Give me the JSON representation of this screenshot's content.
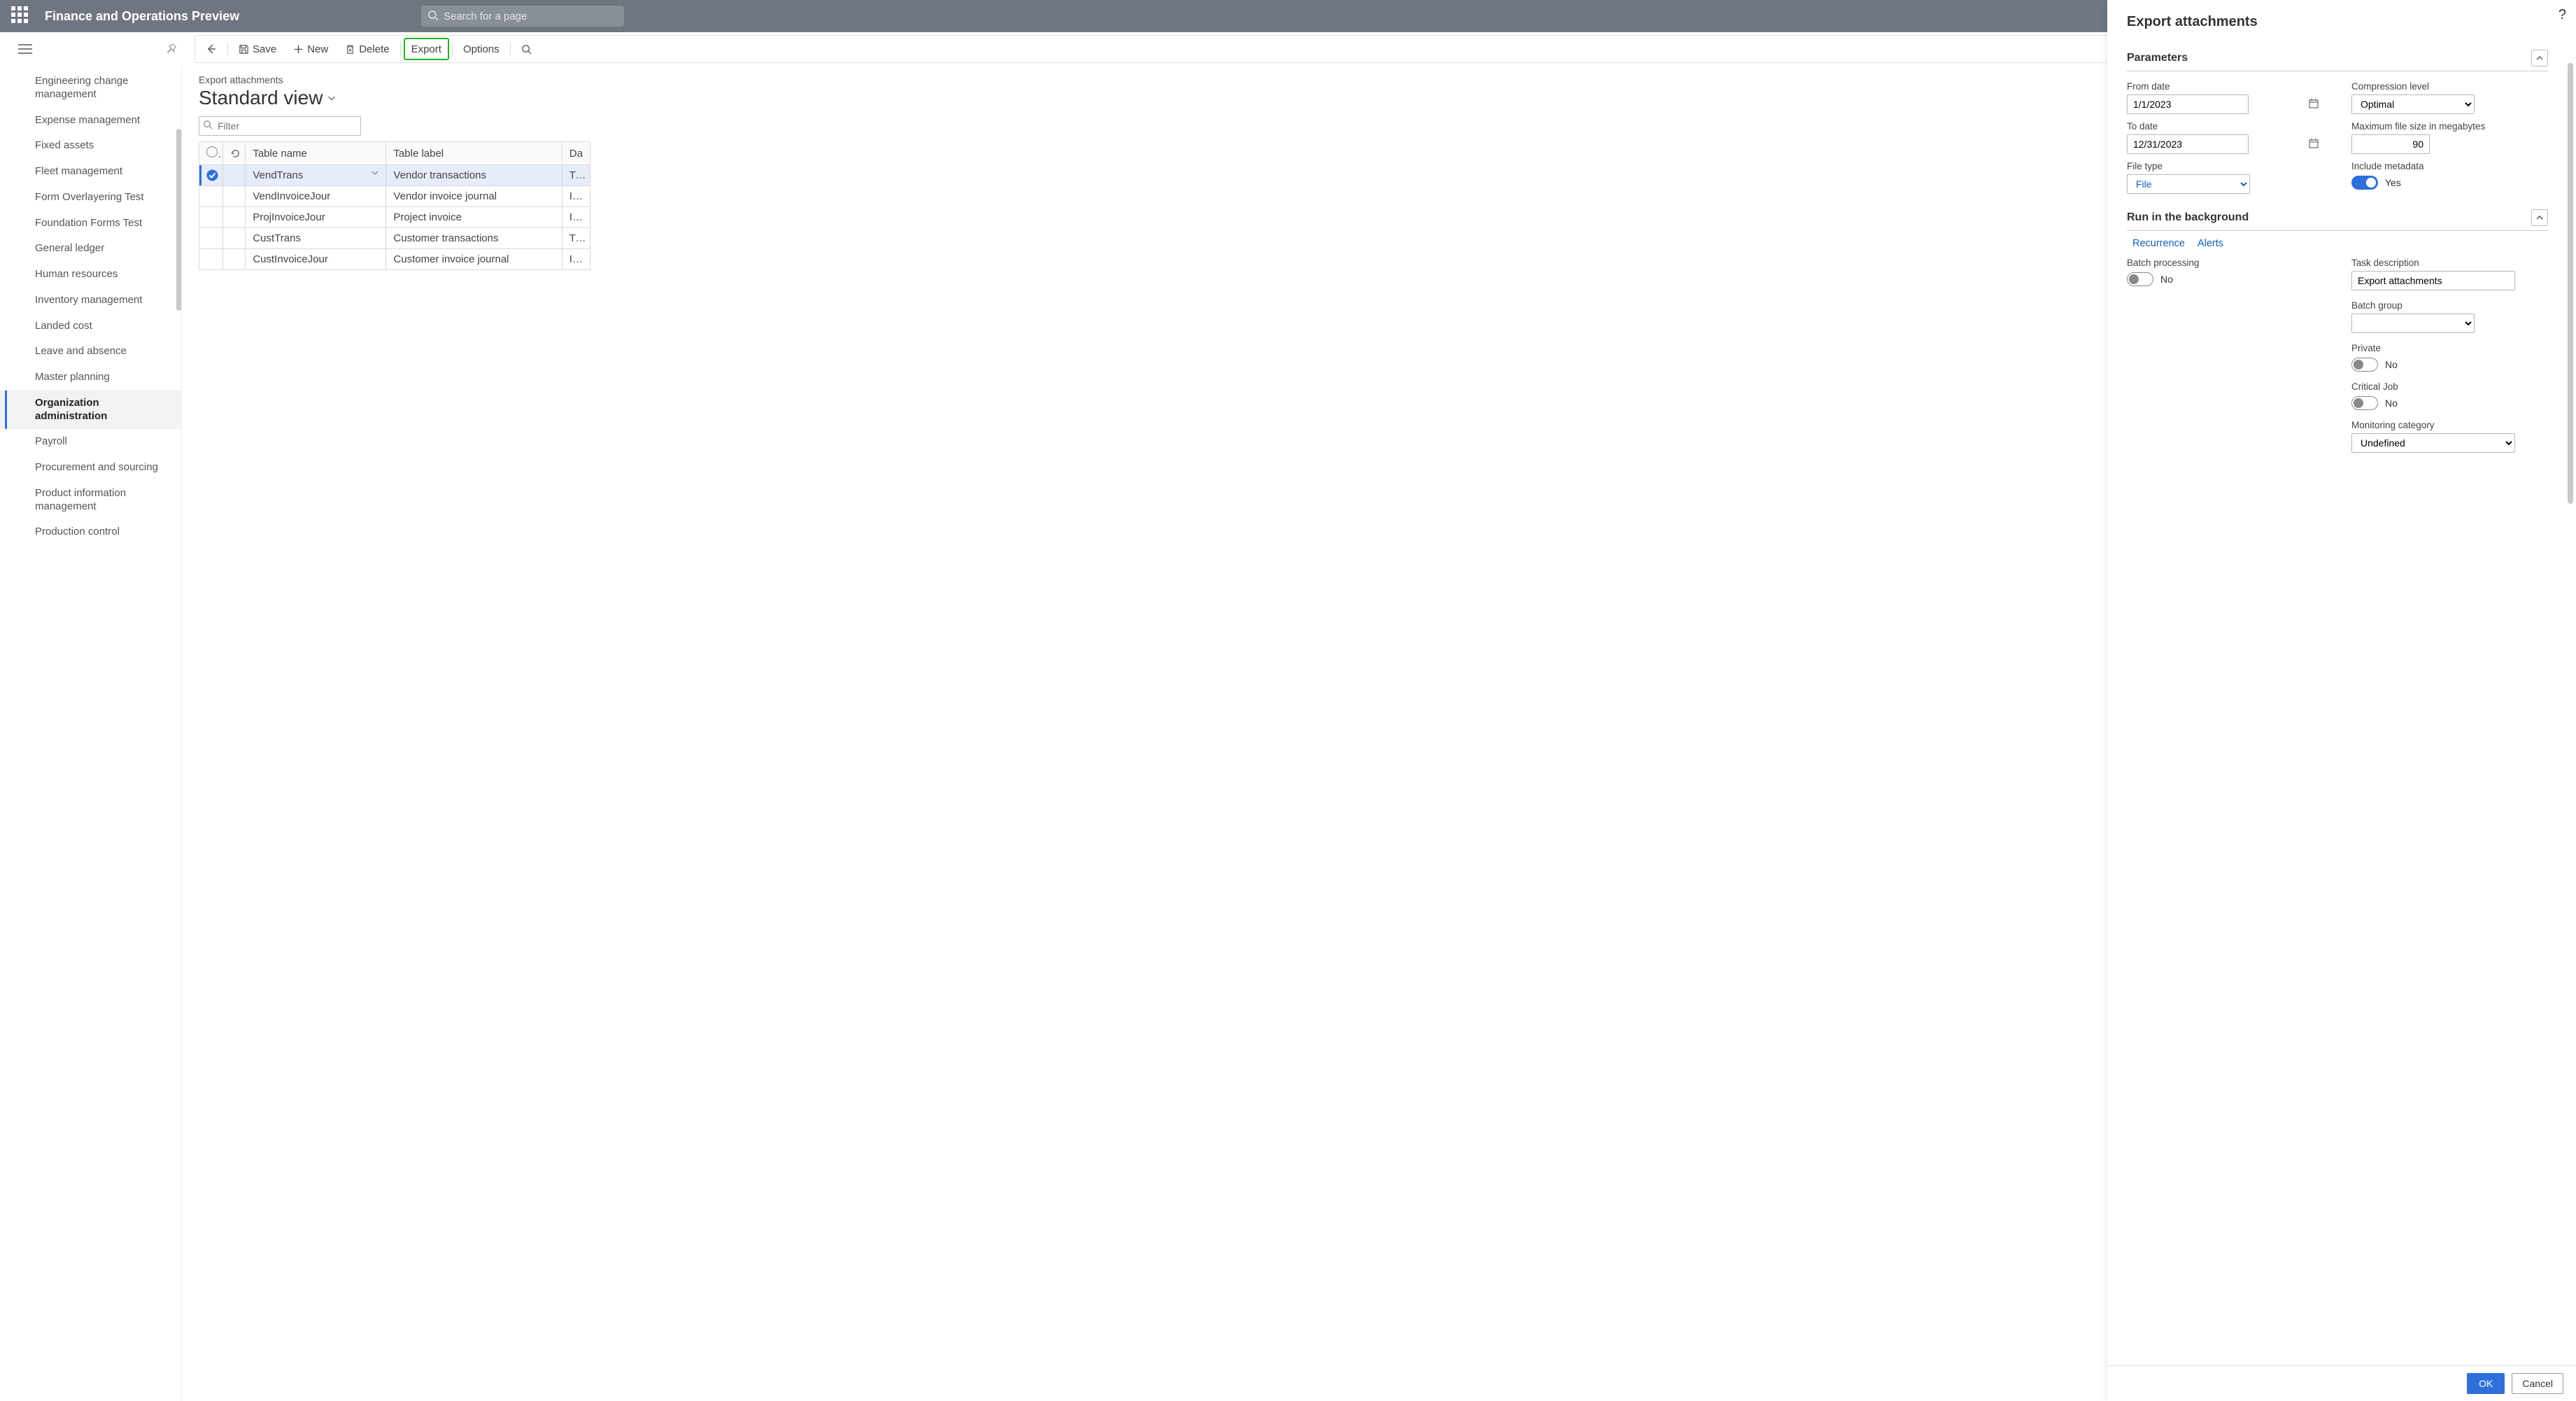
{
  "header": {
    "app_title": "Finance and Operations Preview",
    "search_placeholder": "Search for a page"
  },
  "toolbar": {
    "save": "Save",
    "new": "New",
    "delete": "Delete",
    "export": "Export",
    "options": "Options"
  },
  "sidebar": {
    "items": [
      {
        "label": "Engineering change management"
      },
      {
        "label": "Expense management"
      },
      {
        "label": "Fixed assets"
      },
      {
        "label": "Fleet management"
      },
      {
        "label": "Form Overlayering Test"
      },
      {
        "label": "Foundation Forms Test"
      },
      {
        "label": "General ledger"
      },
      {
        "label": "Human resources"
      },
      {
        "label": "Inventory management"
      },
      {
        "label": "Landed cost"
      },
      {
        "label": "Leave and absence"
      },
      {
        "label": "Master planning"
      },
      {
        "label": "Organization administration"
      },
      {
        "label": "Payroll"
      },
      {
        "label": "Procurement and sourcing"
      },
      {
        "label": "Product information management"
      },
      {
        "label": "Production control"
      }
    ],
    "selected_index": 12
  },
  "page": {
    "breadcrumb": "Export attachments",
    "view_title": "Standard view",
    "filter_placeholder": "Filter"
  },
  "grid": {
    "columns": [
      "Table name",
      "Table label",
      "Da"
    ],
    "rows": [
      {
        "table_name": "VendTrans",
        "table_label": "Vendor transactions",
        "col3": "Tra"
      },
      {
        "table_name": "VendInvoiceJour",
        "table_label": "Vendor invoice journal",
        "col3": "Inv"
      },
      {
        "table_name": "ProjInvoiceJour",
        "table_label": "Project invoice",
        "col3": "Inv"
      },
      {
        "table_name": "CustTrans",
        "table_label": "Customer transactions",
        "col3": "Tra"
      },
      {
        "table_name": "CustInvoiceJour",
        "table_label": "Customer invoice journal",
        "col3": "Inv"
      }
    ],
    "selected_row": 0
  },
  "panel": {
    "title": "Export attachments",
    "sections": {
      "parameters": "Parameters",
      "background": "Run in the background"
    },
    "params": {
      "from_date_label": "From date",
      "from_date": "1/1/2023",
      "to_date_label": "To date",
      "to_date": "12/31/2023",
      "file_type_label": "File type",
      "file_type": "File",
      "compression_label": "Compression level",
      "compression": "Optimal",
      "max_size_label": "Maximum file size in megabytes",
      "max_size": "90",
      "include_meta_label": "Include metadata",
      "include_meta_on": true,
      "include_meta_text": "Yes"
    },
    "background": {
      "recurrence": "Recurrence",
      "alerts": "Alerts",
      "batch_proc_label": "Batch processing",
      "batch_proc_text": "No",
      "task_desc_label": "Task description",
      "task_desc": "Export attachments",
      "batch_group_label": "Batch group",
      "batch_group": "",
      "private_label": "Private",
      "private_text": "No",
      "critical_label": "Critical Job",
      "critical_text": "No",
      "monitoring_label": "Monitoring category",
      "monitoring": "Undefined"
    },
    "footer": {
      "ok": "OK",
      "cancel": "Cancel"
    }
  }
}
